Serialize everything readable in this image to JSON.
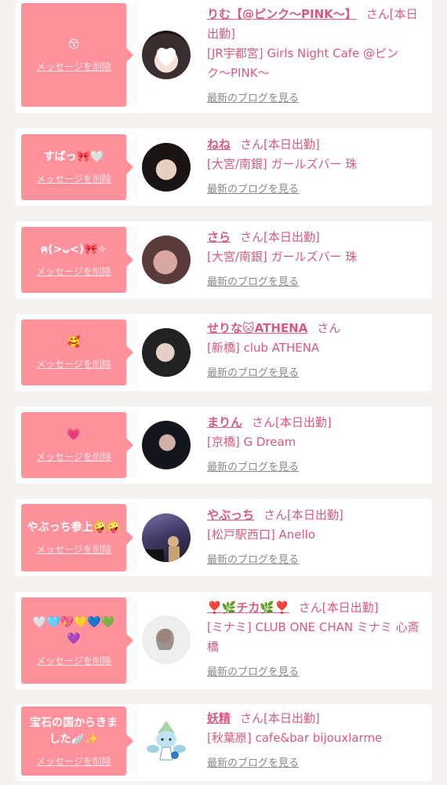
{
  "common": {
    "delete_label": "メッセージを削除",
    "blog_label": "最新のブログを見る",
    "san": "さん"
  },
  "colors": {
    "bubble": "#ff919c",
    "accent_text": "#d85a7e",
    "link_gray": "#888888",
    "page_bg": "#f5f2f2"
  },
  "items": [
    {
      "message": "😚",
      "name": "りむ【@ピンク〜PINK〜】",
      "status": "[本日出勤]",
      "shop": "[JR宇都宮] Girls Night Cafe @ピンク〜PINK〜"
    },
    {
      "message": "すばっ🎀🤍",
      "name": "ねね",
      "status": "[本日出勤]",
      "shop": "[大宮/南銀] ガールズバー 珠"
    },
    {
      "message": "ฅ(>ᴗ<)🎀✧",
      "name": "さら",
      "status": "[本日出勤]",
      "shop": "[大宮/南銀] ガールズバー 珠"
    },
    {
      "message": "🥰",
      "name": "せりな🐱ATHENA",
      "status": "",
      "shop": "[新橋] club ATHENA"
    },
    {
      "message": "💗",
      "name": "まりん",
      "status": "[本日出勤]",
      "shop": "[京橋] G Dream"
    },
    {
      "message": "やぶっち参上🤪🤪",
      "name": "やぶっち",
      "status": "[本日出勤]",
      "shop": "[松戸駅西口] Anello"
    },
    {
      "message": "🤍🩵💖💛💙💚💜",
      "name": "❣️🌿チカ🌿❣️",
      "status": "[本日出勤]",
      "shop": "[ミナミ] CLUB ONE CHAN ミナミ 心斎橋"
    },
    {
      "message": "宝石の国からきました🪽✨",
      "name": "妖精",
      "status": "[本日出勤]",
      "shop": "[秋葉原] cafe&bar bijouxlarme"
    }
  ]
}
